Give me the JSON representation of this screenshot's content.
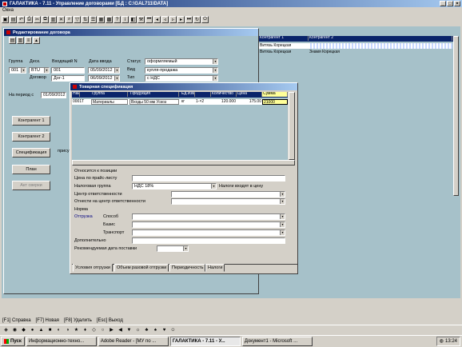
{
  "app": {
    "title": "ГАЛАКТИКА - 7.11 - Управление договорами [БД : C:\\GAL711\\DATA]",
    "menu": "Окна"
  },
  "left_form": {
    "title": "Редактирование договора",
    "labels": {
      "group": "Группа",
      "desc": "Деск.",
      "incoming": "Входящий N",
      "date": "Дата ввода",
      "status": "Статус",
      "contract": "Договор",
      "type_kind": "Вид",
      "type": "Тип",
      "period": "На период с"
    },
    "values": {
      "group": "001",
      "desc": "BTU",
      "incoming": "001",
      "date": "05/09/2012",
      "status": "оформляемый",
      "contract": "Дог-1",
      "contract_date": "06/09/2012",
      "kind": "купля-продажа",
      "type": "с НДС",
      "period_from": "01/09/2012"
    },
    "buttons": {
      "k1": "Контрагент 1",
      "k2": "Контрагент 2",
      "spec": "Спецификация",
      "plan": "План",
      "acts": "Акт сверки"
    },
    "side_label": "прису"
  },
  "right_panel": {
    "columns": [
      "Контрагент 1",
      "Контрагент 2"
    ],
    "rows": [
      [
        "Витязь Корецкая",
        ""
      ],
      [
        "Витязь Корецкая",
        "Знамя Корецкая"
      ]
    ]
  },
  "spec": {
    "title": "Товарная спецификация",
    "columns": [
      "Наи",
      "Группа",
      "Продукция",
      "Ед.Изм",
      "",
      "Количество",
      "Цена",
      "Сумма"
    ],
    "row": {
      "c0": "0001Т",
      "group": "Материалы",
      "product": "Входы 50 мм  Ускоз",
      "unit": "кг",
      "unit2": "1-×2",
      "qty": "120.000",
      "price": "175.00",
      "sum": "21000"
    },
    "section": "Относится к позиции",
    "labels": {
      "price_list": "Цена по прайс-листу",
      "tax_group": "Налоговая группа",
      "tax_note": "Налоги входят в цену",
      "resp_center": "Центр ответственности",
      "resp_center2": "Отнести на центр ответственности",
      "norm": "Норма",
      "shipping": "Отгрузка",
      "method": "Способ",
      "base": "Базис",
      "transport": "Транспорт",
      "extra": "Дополнительно",
      "rec_date": "Рекомендуемая дата поставки"
    },
    "values": {
      "tax_group": "НДС 18%"
    },
    "tabs": [
      "Условия отгрузки",
      "Объем разовой отгрузки",
      "Периодичность",
      "Налоги"
    ]
  },
  "statusbar": [
    "[F1] Справка",
    "[F7] Новая",
    "[F8] Удалить",
    "[Esc] Выход"
  ],
  "taskbar": {
    "start": "Пуск",
    "items": [
      "Информационно-техно...",
      "Adobe Reader - [МУ по ...",
      "ГАЛАКТИКА - 7.11 - У...",
      "Документ1 - Microsoft ..."
    ],
    "clock": "13:24"
  },
  "colors": {
    "title_dark": "#0a246a",
    "title_light": "#a6caf0",
    "window_bg": "#d4d0c8",
    "desktop": "#a6c1c9",
    "grid_sel": "#c8d8ff",
    "sum_field": "#ffff99"
  }
}
